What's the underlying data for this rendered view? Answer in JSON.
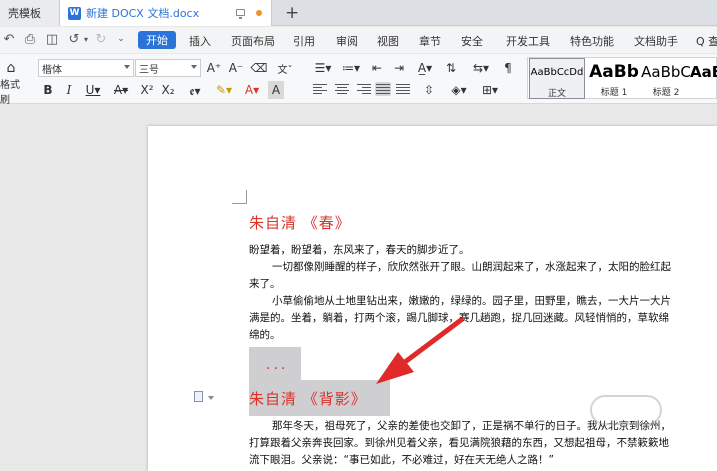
{
  "tabs": [
    {
      "label": "壳模板"
    },
    {
      "label": "新建 DOCX 文档.docx",
      "badge": "W"
    }
  ],
  "menu": {
    "active": "开始",
    "items": [
      "插入",
      "页面布局",
      "引用",
      "审阅",
      "视图",
      "章节",
      "安全",
      "开发工具",
      "特色功能",
      "文档助手"
    ],
    "overflow": "Q 查"
  },
  "ribbon": {
    "format_painter_label": "格式刷",
    "font_name": "楷体",
    "font_size": "三号",
    "styles": [
      {
        "preview": "AaBbCcDd",
        "name": "正文"
      },
      {
        "preview": "AaBb",
        "name": "标题 1"
      },
      {
        "preview": "AaBbC",
        "name": "标题 2"
      },
      {
        "preview": "AaB",
        "name": ""
      }
    ]
  },
  "document": {
    "heading1": "朱自清 《春》",
    "lines": [
      "盼望着，盼望着，东风来了，春天的脚步近了。",
      "一切都像刚睡醒的样子，欣欣然张开了眼。山朗润起来了，水涨起来了，太阳的脸红起",
      "来了。",
      "小草偷偷地从土地里钻出来，嫩嫩的，绿绿的。园子里，田野里，瞧去，一大片一大片",
      "满是的。坐着，躺着，打两个滚，踢几脚球，赛几趟跑，捉几回迷藏。风轻悄悄的，草软绵",
      "绵的。"
    ],
    "ellipsis": "...",
    "heading2": "朱自清 《背影》",
    "lines2": [
      "那年冬天，祖母死了，父亲的差使也交卸了，正是祸不单行的日子。我从北京到徐州，",
      "打算跟着父亲奔丧回家。到徐州见着父亲，看见满院狼藉的东西，又想起祖母，不禁簌簌地",
      "流下眼泪。父亲说：“事已如此，不必难过，好在天无绝人之路！”"
    ]
  },
  "colors": {
    "heading": "#d8342c",
    "accent": "#2b73d8",
    "arrow": "#e02a2a",
    "selection": "#cfcfd2"
  }
}
